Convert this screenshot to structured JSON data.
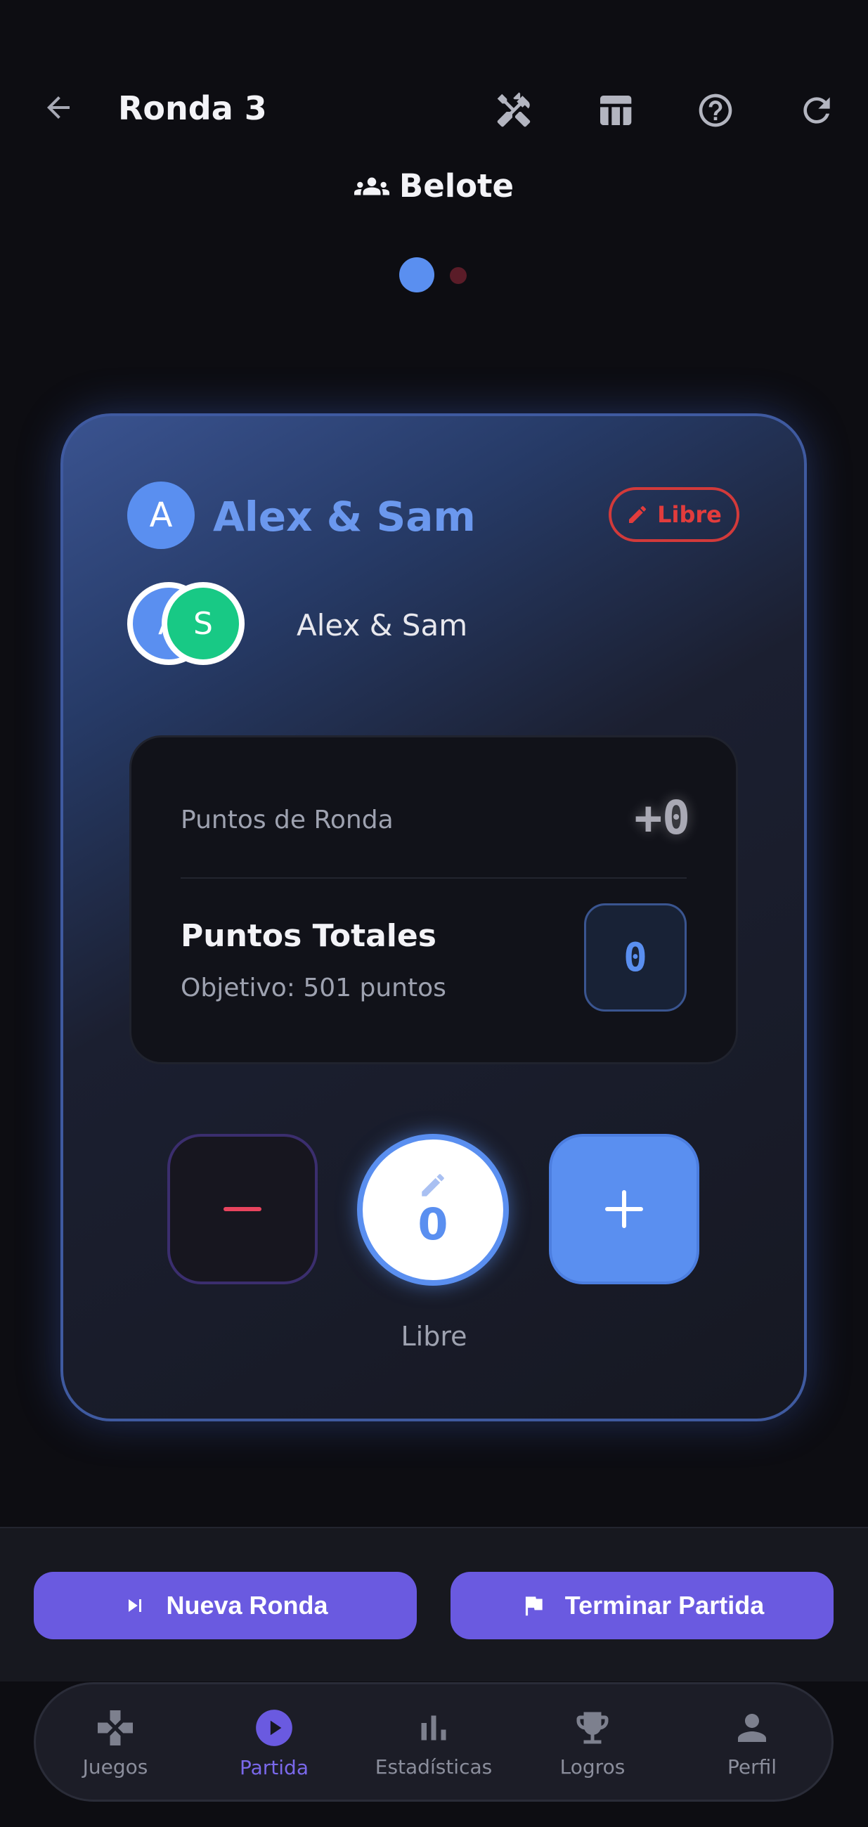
{
  "app_bar": {
    "title": "Ronda 3",
    "game_name": "Belote",
    "icons": [
      "arrow-back-icon",
      "tools-icon",
      "table-icon",
      "help-icon",
      "refresh-icon"
    ]
  },
  "pager": {
    "pages": 2,
    "active_index": 0
  },
  "team": {
    "avatar_letter": "A",
    "name": "Alex & Sam",
    "mode_badge": "Libre",
    "members": [
      {
        "initial": "A",
        "color": "#5a8ff0"
      },
      {
        "initial": "S",
        "color": "#18c985"
      }
    ],
    "members_label": "Alex & Sam"
  },
  "scores": {
    "round_label": "Puntos de Ronda",
    "round_value": "+0",
    "total_label": "Puntos Totales",
    "goal_text": "Objetivo: 501 puntos",
    "total_value": "0"
  },
  "controls": {
    "current_value": "0",
    "mode_caption": "Libre"
  },
  "actions": {
    "new_round": "Nueva Ronda",
    "end_game": "Terminar Partida"
  },
  "nav": {
    "items": [
      {
        "label": "Juegos",
        "icon": "gamepad-icon",
        "active": false
      },
      {
        "label": "Partida",
        "icon": "play-circle-icon",
        "active": true
      },
      {
        "label": "Estadísticas",
        "icon": "bar-chart-icon",
        "active": false
      },
      {
        "label": "Logros",
        "icon": "trophy-icon",
        "active": false
      },
      {
        "label": "Perfil",
        "icon": "person-icon",
        "active": false
      }
    ]
  },
  "colors": {
    "background": "#0d0d12",
    "accent_blue": "#5a8ff0",
    "accent_purple": "#6a5ae0",
    "danger": "#e23c3c",
    "green": "#18c985"
  }
}
